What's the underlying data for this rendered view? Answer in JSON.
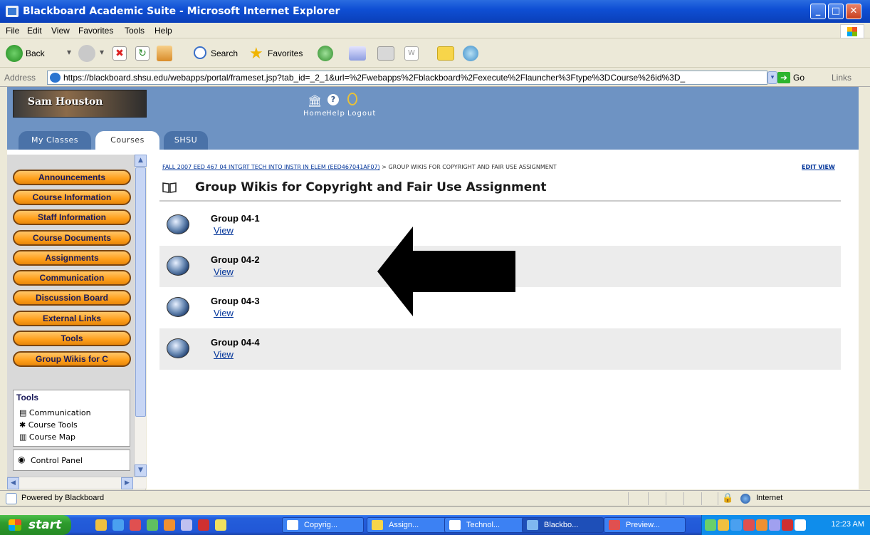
{
  "window": {
    "title": "Blackboard Academic Suite - Microsoft Internet Explorer"
  },
  "menu": [
    "File",
    "Edit",
    "View",
    "Favorites",
    "Tools",
    "Help"
  ],
  "toolbar": {
    "back": "Back",
    "search": "Search",
    "favorites": "Favorites"
  },
  "address": {
    "label": "Address",
    "url": "https://blackboard.shsu.edu/webapps/portal/frameset.jsp?tab_id=_2_1&url=%2Fwebapps%2Fblackboard%2Fexecute%2Flauncher%3Ftype%3DCourse%26id%3D_",
    "go": "Go",
    "links": "Links"
  },
  "header": {
    "logo_text": "Sam Houston",
    "nav": [
      "Home",
      "Help",
      "Logout"
    ],
    "tabs": [
      "My Classes",
      "Courses",
      "SHSU"
    ]
  },
  "course_menu": [
    "Announcements",
    "Course Information",
    "Staff Information",
    "Course Documents",
    "Assignments",
    "Communication",
    "Discussion Board",
    "External Links",
    "Tools",
    "Group Wikis for C"
  ],
  "tools_panel": {
    "title": "Tools",
    "items": [
      "Communication",
      "Course Tools",
      "Course Map"
    ],
    "control_panel": "Control Panel"
  },
  "content": {
    "breadcrumb_link": "FALL 2007 EED 467 04 INTGRT TECH INTO INSTR IN ELEM (EED467041AF07)",
    "breadcrumb_current": " > GROUP WIKIS FOR COPYRIGHT AND FAIR USE ASSIGNMENT",
    "edit_view": "EDIT VIEW",
    "title": "Group Wikis for Copyright and Fair Use Assignment",
    "groups": [
      {
        "name": "Group 04-1",
        "link": "View"
      },
      {
        "name": "Group 04-2",
        "link": "View"
      },
      {
        "name": "Group 04-3",
        "link": "View"
      },
      {
        "name": "Group 04-4",
        "link": "View"
      }
    ]
  },
  "status": {
    "text": "Powered by Blackboard",
    "zone": "Internet"
  },
  "taskbar": {
    "start": "start",
    "tasks": [
      "Copyrig...",
      "Assign...",
      "Technol...",
      "Blackbo...",
      "Preview..."
    ],
    "clock": "12:23 AM"
  }
}
